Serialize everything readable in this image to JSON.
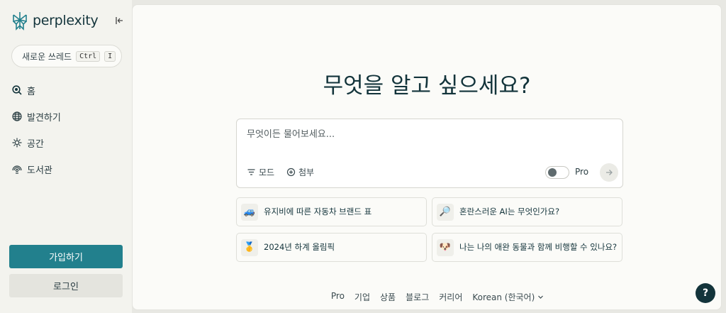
{
  "brand": {
    "name": "perplexity"
  },
  "sidebar": {
    "new_thread": {
      "label": "새로운 쓰레드",
      "shortcut_mod": "Ctrl",
      "shortcut_key": "I"
    },
    "items": [
      {
        "label": "홈",
        "icon": "search-home-icon"
      },
      {
        "label": "발견하기",
        "icon": "globe-icon"
      },
      {
        "label": "공간",
        "icon": "spaces-icon"
      },
      {
        "label": "도서관",
        "icon": "library-icon"
      }
    ],
    "signup_label": "가입하기",
    "login_label": "로그인"
  },
  "main": {
    "headline": "무엇을 알고 싶으세요?",
    "search": {
      "placeholder": "무엇이든 물어보세요...",
      "mode_label": "모드",
      "attach_label": "첨부",
      "pro_label": "Pro",
      "pro_enabled": false
    },
    "suggestions": [
      {
        "emoji": "🚙",
        "text": "유지비에 따른 자동차 브랜드 표"
      },
      {
        "emoji": "🔎",
        "text": "혼란스러운 AI는 무엇인가요?"
      },
      {
        "emoji": "🥇",
        "text": "2024년 하계 올림픽"
      },
      {
        "emoji": "🐶",
        "text": "나는 나의 애완 동물과 함께 비행할 수 있나요?"
      }
    ],
    "footer": {
      "links": [
        "Pro",
        "기업",
        "상품",
        "블로그",
        "커리어"
      ],
      "language": "Korean (한국어)"
    }
  },
  "help_label": "?",
  "colors": {
    "accent": "#22808d",
    "text": "#13343b",
    "sidebar_bg": "#f3f3ee",
    "main_bg": "#fbfbf8"
  }
}
